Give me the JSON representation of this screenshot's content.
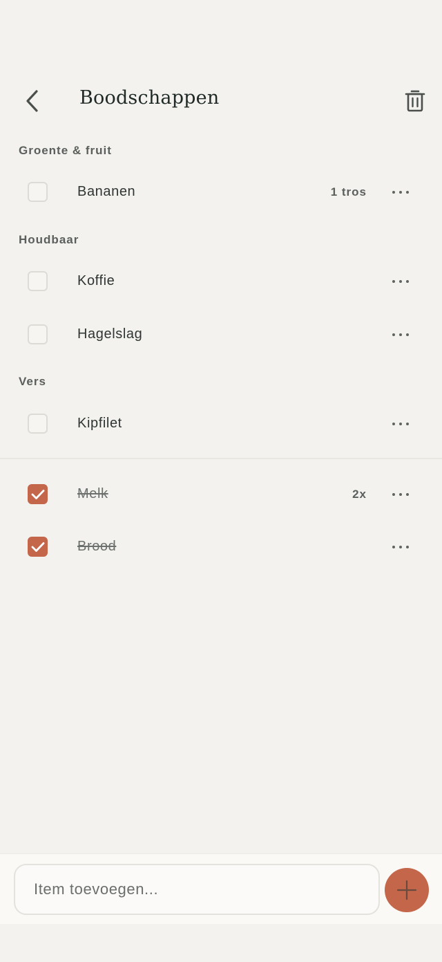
{
  "header": {
    "back_icon": "chevron-left-icon",
    "title": "Boodschappen",
    "trash_icon": "trash-icon"
  },
  "sections": [
    {
      "title": "Groente & fruit",
      "items": [
        {
          "label": "Bananen",
          "quantity": "1 tros",
          "checked": false
        }
      ]
    },
    {
      "title": "Houdbaar",
      "items": [
        {
          "label": "Koffie",
          "quantity": "",
          "checked": false
        },
        {
          "label": "Hagelslag",
          "quantity": "",
          "checked": false
        }
      ]
    },
    {
      "title": "Vers",
      "items": [
        {
          "label": "Kipfilet",
          "quantity": "",
          "checked": false
        }
      ]
    }
  ],
  "completed": [
    {
      "label": "Melk",
      "quantity": "2x",
      "checked": true
    },
    {
      "label": "Brood",
      "quantity": "",
      "checked": true
    }
  ],
  "add_bar": {
    "placeholder": "Item toevoegen...",
    "add_icon": "plus-icon"
  },
  "colors": {
    "accent": "#c4664a",
    "background": "#f3f2ef"
  }
}
